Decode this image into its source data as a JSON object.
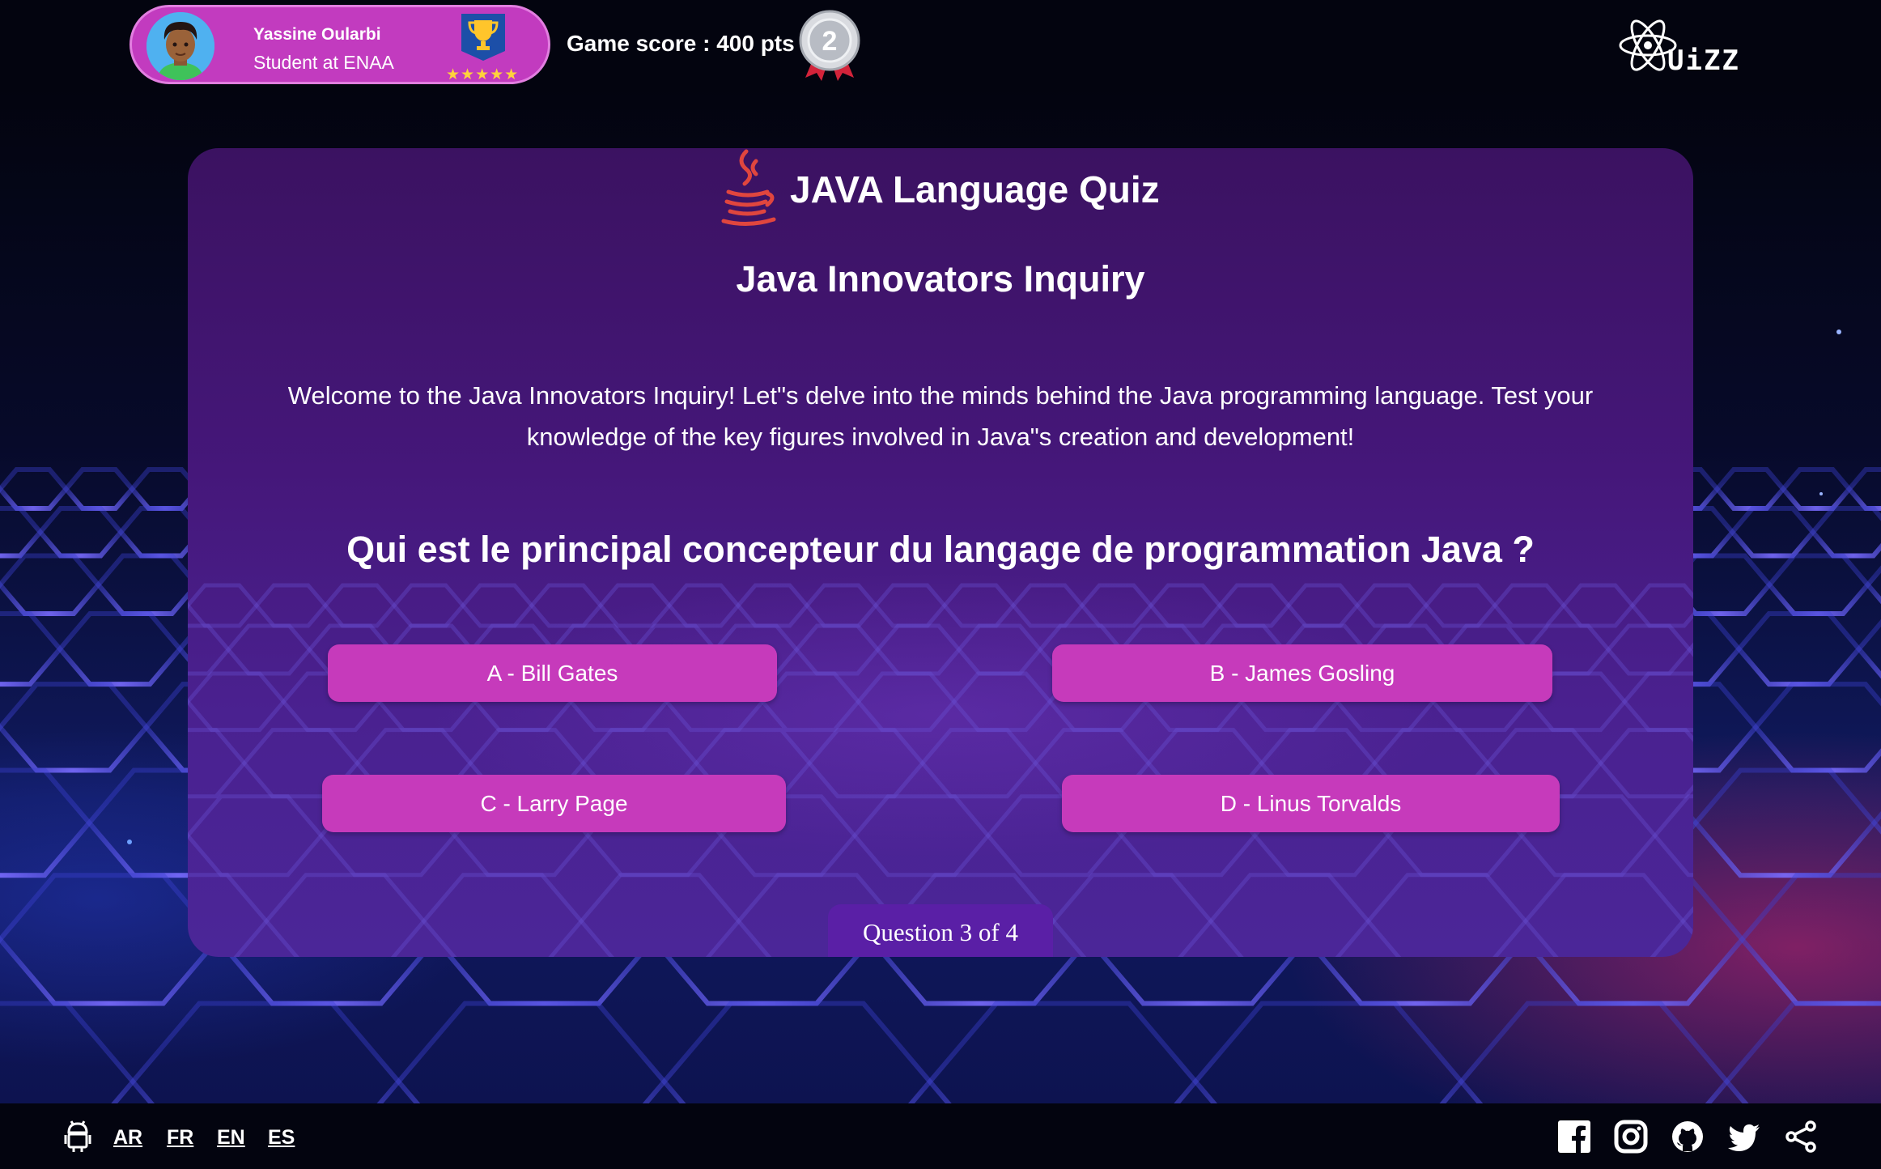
{
  "header": {
    "user_name": "Yassine Oularbi",
    "user_role": "Student at ENAA",
    "rating_stars": "★★★★★",
    "score_text": "Game score : 400 pts",
    "medal_rank": "2",
    "logo_text": "UiZZ",
    "icons": [
      "avatar",
      "trophy-icon",
      "medal-icon",
      "quiz-logo"
    ]
  },
  "quiz": {
    "title": "JAVA Language Quiz",
    "subtitle": "Java Innovators Inquiry",
    "intro": "Welcome to the Java Innovators Inquiry! Let\"s delve into the minds behind the Java programming language. Test your knowledge of the key figures involved in Java\"s creation and development!",
    "question": "Qui est le principal concepteur du langage de programmation Java ?",
    "answers": [
      {
        "label": "A - Bill Gates"
      },
      {
        "label": "B - James Gosling"
      },
      {
        "label": "C - Larry Page"
      },
      {
        "label": "D - Linus Torvalds"
      }
    ],
    "progress_text": "Question 3 of 4",
    "progress": {
      "current": 3,
      "total": 4
    }
  },
  "footer": {
    "languages": [
      "AR",
      "FR",
      "EN",
      "ES"
    ],
    "social_icons": [
      "facebook-icon",
      "instagram-icon",
      "github-icon",
      "twitter-icon",
      "share-icon"
    ]
  },
  "colors": {
    "accent": "#c63abb",
    "card": "#45177a",
    "topbar": "#03040f"
  }
}
